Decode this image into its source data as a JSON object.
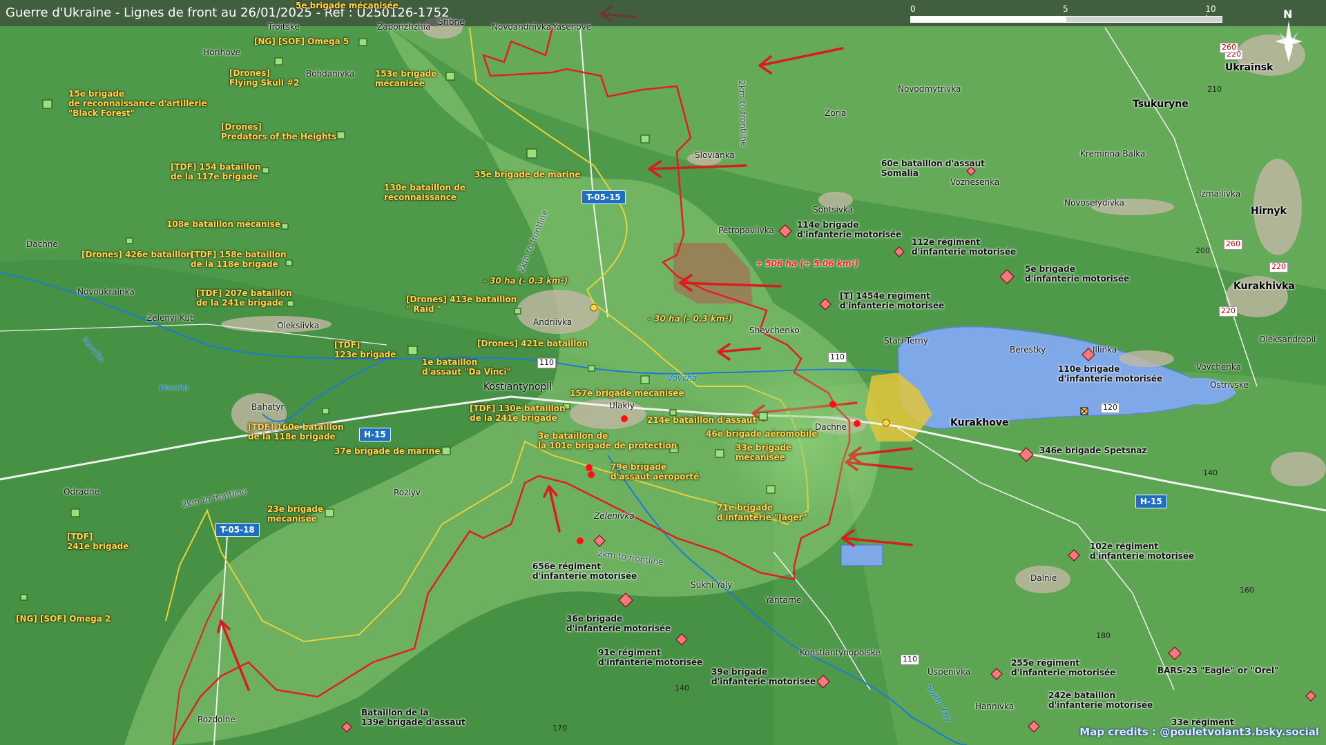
{
  "title": "Guerre d'Ukraine - Lignes de front au 26/01/2025 - Ref : U250126-1752",
  "scale": {
    "labels": [
      "0",
      "5",
      "10 km"
    ]
  },
  "north": "N",
  "credits": "Map credits : @pouletvolant3.bsky.social",
  "colors": {
    "ukraine_units": "#ffd54a",
    "frontline": "#e02020",
    "yellow_line": "#e8d23a",
    "water": "#7fa8e8",
    "terrain": "#4f9a4a"
  },
  "road_labels": [
    "T-05-15",
    "H-15",
    "T-05-18",
    "H-15"
  ],
  "route_numbers": [
    "110",
    "110",
    "110",
    "120",
    "220",
    "220",
    "220",
    "260",
    "260"
  ],
  "annotations": {
    "loss1": "- 30 ha (- 0.3 km²)",
    "loss2": "- 30 ha (- 0.3 km²)",
    "gain": "+ 506 ha (+ 5.06 km²)",
    "buffer1": "2km to frontline",
    "buffer2": "2km to frontline",
    "buffer3": "2km to frontline",
    "buffer4": "2km to frontline"
  },
  "rivers": [
    "Vovcha",
    "Vovcha",
    "Vovcha",
    "Sukhi Yaly"
  ],
  "altitudes": [
    "210",
    "200",
    "170",
    "140",
    "180",
    "180",
    "160",
    "140",
    "140",
    "170"
  ],
  "places": [
    "Troitske",
    "Zaporizhzhia",
    "Sribne",
    "Novoandriivka",
    "Yasenove",
    "Horihove",
    "Bohdanivka",
    "Novodmytrivka",
    "Zoria",
    "Tsukuryne",
    "Kreminna Balka",
    "Slovianka",
    "Voznesenka",
    "Sontsivka",
    "Novoselydivka",
    "Izmailivka",
    "Petropavlivka",
    "Dachne",
    "Novoukrainka",
    "Zelenyi Kut",
    "Oleksiivka",
    "Andriivka",
    "Shevchenko",
    "Stari Terny",
    "Berestky",
    "Illinka",
    "Oleksandropil",
    "Vovchenka",
    "Ostrivske",
    "Kostiantynopil",
    "Ulakly",
    "Dachne",
    "Bahatyr",
    "Odradne",
    "Rozlyv",
    "Zelenivka",
    "Sukhi Yaly",
    "Yantarne",
    "Dalnie",
    "Konstiantynopolske",
    "Uspenivka",
    "Hannivka",
    "Rozdolne"
  ],
  "towns": [
    "Ukrainsk",
    "Hirnyk",
    "Kurakhivka",
    "Kurakhove"
  ],
  "ukraine_units": [
    "5e brigade mécanisée",
    "[NG] [SOF] Omega 5",
    "[Drones]\nFlying Skull #2",
    "153e brigade\nmécanisée",
    "15e brigade\nde reconnaissance d'artillerie\n\"Black Forest\"",
    "[Drones]\nPredators of the Heights",
    "[TDF] 154 bataillon\nde la 117e brigade",
    "130e bataillon de\nreconnaissance",
    "35e brigade de marine",
    "108e bataillon mécanisé",
    "[Drones] 426e bataillon",
    "[TDF] 158e bataillon\nde la 118e brigade",
    "[TDF] 207e bataillon\nde la 241e brigade",
    "[Drones] 413e bataillon\n\" Raid \"",
    "[TDF]\n123e brigade",
    "1e bataillon\nd'assaut \"Da Vinci\"",
    "[Drones] 421e bataillon",
    "157e brigade mécanisée",
    "[TDF] 130e bataillon\nde la 241e brigade",
    "214e bataillon d'assaut",
    "46e brigade aéromobile",
    "3e bataillon de\nla 101e brigade de protection",
    "33e brigade\nmécanisée",
    "[TDF] 160e bataillon\nde la 118e brigade",
    "37e brigade de marine",
    "79e brigade\nd'assaut aéroporté",
    "71e brigade\nd'infanterie \"Jager\"",
    "23e brigade\nmécanisée",
    "[TDF]\n241e brigade",
    "[NG] [SOF] Omega 2"
  ],
  "russia_units": [
    "60e bataillon d'assaut\nSomalia",
    "114e brigade\nd'infanterie motorisée",
    "112e régiment\nd'infanterie motorisée",
    "5e brigade\nd'infanterie motorisée",
    "[T] 1454e régiment\nd'infanterie motorisée",
    "110e brigade\nd'infanterie motorisée",
    "346e brigade Spetsnaz",
    "102e régiment\nd'infanterie motorisée",
    "656e régiment\nd'infanterie motorisée",
    "36e brigade\nd'infanterie motorisée",
    "91e régiment\nd'infanterie motorisée",
    "39e brigade\nd'infanterie motorisée",
    "255e régiment\nd'infanterie motorisée",
    "BARS-23 \"Eagle\" or \"Orel\"",
    "242e bataillon\nd'infanterie motorisée",
    "Bataillon de la\n139e brigade d'assaut",
    "33e régiment"
  ]
}
